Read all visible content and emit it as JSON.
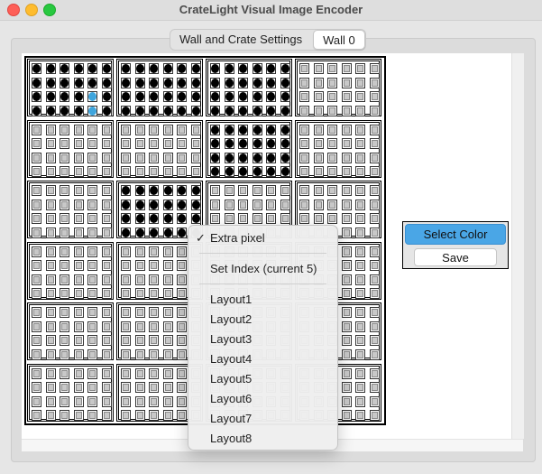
{
  "window": {
    "title": "CrateLight Visual Image Encoder"
  },
  "tabs": [
    {
      "label": "Wall and Crate Settings",
      "active": false
    },
    {
      "label": "Wall 0",
      "active": true
    }
  ],
  "side_panel": {
    "select_color_label": "Select Color",
    "save_label": "Save",
    "accent_color": "#4aa6e6"
  },
  "wall": {
    "crate_columns": 4,
    "crate_rows": 6,
    "pixels_per_crate_cols": 6,
    "pixels_per_crate_rows": 4,
    "lit_color": "#000000",
    "blue_color": "#3ea5dd",
    "lit_crates": [
      {
        "crate": [
          0,
          0
        ],
        "pattern": "full",
        "blue_pixels": [
          [
            4,
            2
          ],
          [
            4,
            3
          ]
        ]
      },
      {
        "crate": [
          1,
          0
        ],
        "pattern": "full"
      },
      {
        "crate": [
          2,
          0
        ],
        "pattern": "full"
      },
      {
        "crate": [
          2,
          1
        ],
        "pattern": "full"
      },
      {
        "crate": [
          1,
          2
        ],
        "pattern": "full"
      }
    ]
  },
  "context_menu": {
    "items": [
      {
        "label": "Extra pixel",
        "checked": true
      },
      {
        "separator": true
      },
      {
        "label": "Set Index (current 5)",
        "checked": false
      },
      {
        "separator": true
      },
      {
        "label": "Layout1",
        "checked": false
      },
      {
        "label": "Layout2",
        "checked": false
      },
      {
        "label": "Layout3",
        "checked": false
      },
      {
        "label": "Layout4",
        "checked": false
      },
      {
        "label": "Layout5",
        "checked": false
      },
      {
        "label": "Layout6",
        "checked": false
      },
      {
        "label": "Layout7",
        "checked": false
      },
      {
        "label": "Layout8",
        "checked": false
      }
    ]
  }
}
